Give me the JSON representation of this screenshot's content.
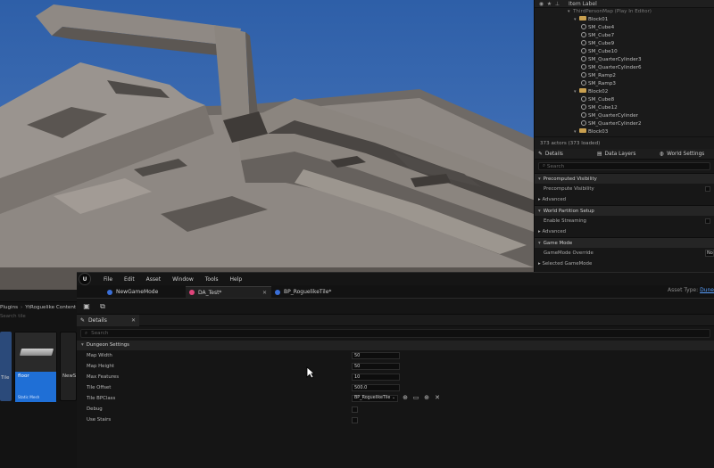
{
  "outliner": {
    "header_label": "Item Label",
    "rows": [
      {
        "label": "ThirdPersonMap (Play In Editor)",
        "kind": "map",
        "indent": 0
      },
      {
        "label": "Block01",
        "kind": "folder",
        "indent": 1
      },
      {
        "label": "SM_Cube4",
        "kind": "mesh",
        "indent": 2
      },
      {
        "label": "SM_Cube7",
        "kind": "mesh",
        "indent": 2
      },
      {
        "label": "SM_Cube9",
        "kind": "mesh",
        "indent": 2
      },
      {
        "label": "SM_Cube10",
        "kind": "mesh",
        "indent": 2
      },
      {
        "label": "SM_QuarterCylinder3",
        "kind": "mesh",
        "indent": 2
      },
      {
        "label": "SM_QuarterCylinder6",
        "kind": "mesh",
        "indent": 2
      },
      {
        "label": "SM_Ramp2",
        "kind": "mesh",
        "indent": 2
      },
      {
        "label": "SM_Ramp3",
        "kind": "mesh",
        "indent": 2
      },
      {
        "label": "Block02",
        "kind": "folder",
        "indent": 1
      },
      {
        "label": "SM_Cube8",
        "kind": "mesh",
        "indent": 2
      },
      {
        "label": "SM_Cube12",
        "kind": "mesh",
        "indent": 2
      },
      {
        "label": "SM_QuarterCylinder",
        "kind": "mesh",
        "indent": 2
      },
      {
        "label": "SM_QuarterCylinder2",
        "kind": "mesh",
        "indent": 2
      },
      {
        "label": "Block03",
        "kind": "folder",
        "indent": 1
      }
    ],
    "footer": "373 actors (373 loaded)"
  },
  "details_right": {
    "tabs": [
      "Details",
      "Data Layers",
      "World Settings"
    ],
    "search_placeholder": "Search",
    "sections": {
      "precomputed_visibility": "Precomputed Visibility",
      "precompute_visibility": "Precompute Visibility",
      "advanced_1": "Advanced",
      "world_partition_setup": "World Partition Setup",
      "enable_streaming": "Enable Streaming",
      "advanced_2": "Advanced",
      "game_mode": "Game Mode",
      "gamemode_override": "GameMode Override",
      "gamemode_override_value": "No",
      "selected_gamemode": "Selected GameMode"
    }
  },
  "content_browser": {
    "path": [
      "Plugins",
      "YtRoguelike Content"
    ],
    "search_placeholder": "Search tile",
    "tiles": {
      "left_label": "Tile",
      "floor_name": "floor",
      "floor_type": "Static Mesh",
      "right_label": "NewS"
    }
  },
  "asset_editor": {
    "menu": [
      "File",
      "Edit",
      "Asset",
      "Window",
      "Tools",
      "Help"
    ],
    "tabs": [
      {
        "label": "NewGameMode",
        "color": "#3a6fd8"
      },
      {
        "label": "DA_Test*",
        "color": "#e0457b"
      },
      {
        "label": "BP_RoguelikeTile*",
        "color": "#3a6fd8"
      }
    ],
    "asset_type_label": "Asset Type:",
    "asset_type_value": "Dune",
    "details_tab": "Details",
    "search_placeholder": "Search",
    "section": "Dungeon Settings",
    "properties": {
      "map_width": {
        "label": "Map Width",
        "value": "50"
      },
      "map_height": {
        "label": "Map Height",
        "value": "50"
      },
      "max_features": {
        "label": "Max Features",
        "value": "10"
      },
      "tile_offset": {
        "label": "Tile Offset",
        "value": "500.0"
      },
      "tile_bpclass": {
        "label": "Tile BPClass",
        "value": "BP_RoguelikeTile"
      },
      "debug": {
        "label": "Debug",
        "checked": false
      },
      "use_stairs": {
        "label": "Use Stairs",
        "checked": false
      }
    }
  }
}
